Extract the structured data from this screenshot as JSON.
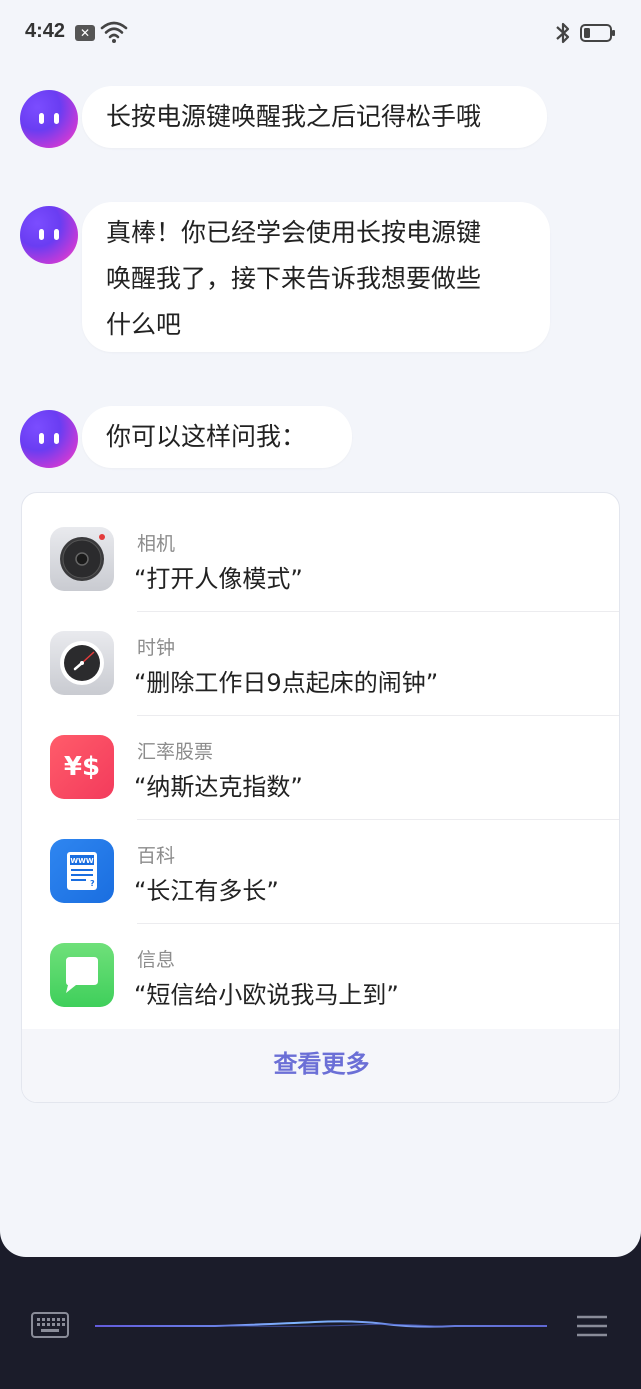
{
  "status_bar": {
    "time": "4:42",
    "icons": [
      "notification-x-icon",
      "wifi-icon",
      "bluetooth-icon",
      "battery-icon"
    ]
  },
  "messages": [
    {
      "text_lines": [
        "长按电源键唤醒我之后记得松手哦"
      ]
    },
    {
      "text_lines": [
        "真棒！你已经学会使用长按电源键",
        "唤醒我了，接下来告诉我想要做些",
        "什么吧"
      ]
    },
    {
      "text_lines": [
        "你可以这样问我："
      ]
    }
  ],
  "suggestions": [
    {
      "app": "相机",
      "query": "“打开人像模式”",
      "icon": "camera-icon"
    },
    {
      "app": "时钟",
      "query": "“删除工作日9点起床的闹钟”",
      "icon": "clock-icon"
    },
    {
      "app": "汇率股票",
      "query": "“纳斯达克指数”",
      "icon": "currency-stock-icon"
    },
    {
      "app": "百科",
      "query": "“长江有多长”",
      "icon": "encyclopedia-icon"
    },
    {
      "app": "信息",
      "query": "“短信给小欧说我马上到”",
      "icon": "messages-icon"
    }
  ],
  "see_more": "查看更多",
  "icon_texts": {
    "currency": "¥$",
    "www": "WWW"
  },
  "bottom_bar": {
    "icons": [
      "keyboard-icon",
      "voice-wave-icon",
      "menu-icon"
    ]
  },
  "colors": {
    "accent": "#6b6fd6",
    "background": "#f3f5fa",
    "bottom_dark": "#1b1c2a"
  }
}
